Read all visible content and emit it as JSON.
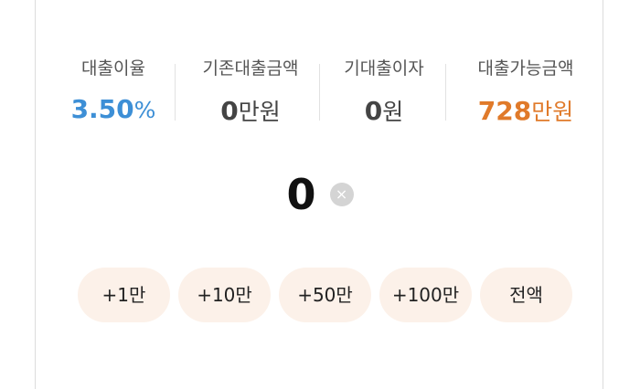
{
  "header": {
    "cut_text": "··· ···· ·"
  },
  "stats": [
    {
      "label": "대출이율",
      "value": "3.50",
      "unit": "%",
      "color": "#3d8fd6"
    },
    {
      "label": "기존대출금액",
      "value": "0",
      "unit": "만원",
      "color": "#444444"
    },
    {
      "label": "기대출이자",
      "value": "0",
      "unit": "원",
      "color": "#444444"
    },
    {
      "label": "대출가능금액",
      "value": "728",
      "unit": "만원",
      "color": "#e07a2a"
    }
  ],
  "amount": {
    "value": "0",
    "clear_icon": "×"
  },
  "chips": [
    {
      "label": "+1만"
    },
    {
      "label": "+10만"
    },
    {
      "label": "+50만"
    },
    {
      "label": "+100만"
    },
    {
      "label": "전액"
    }
  ],
  "colors": {
    "chip_bg": "#fcf1e9",
    "rate": "#3d8fd6",
    "available": "#e07a2a"
  }
}
